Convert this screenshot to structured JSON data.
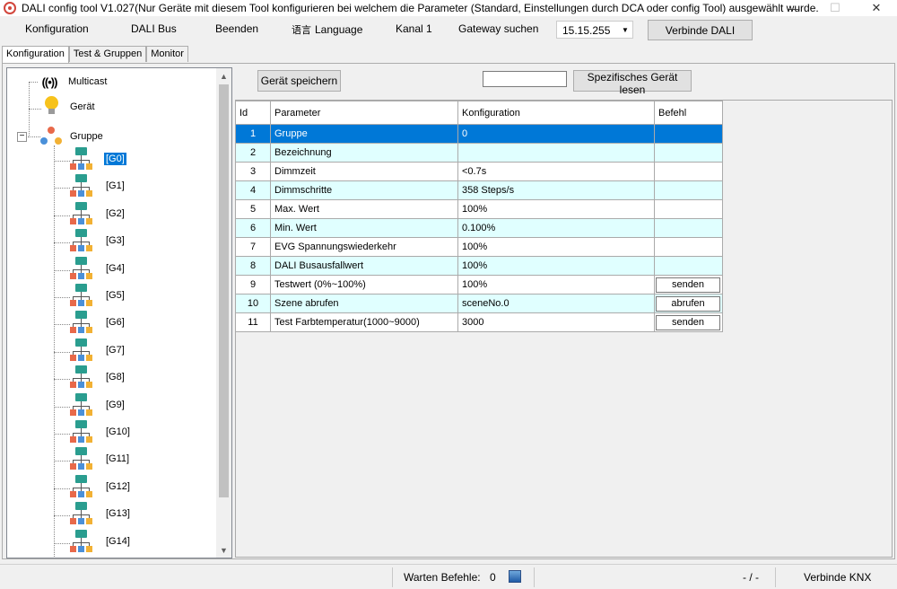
{
  "window": {
    "title": "DALI config tool V1.027(Nur Geräte mit diesem Tool konfigurieren bei welchem die Parameter (Standard, Einstellungen durch DCA oder config Tool) ausgewählt wurde.",
    "controls": {
      "minimize": "—",
      "maximize": "☐",
      "close": "✕"
    }
  },
  "menu": {
    "konfiguration": "Konfiguration",
    "dali_bus": "DALI Bus",
    "beenden": "Beenden",
    "language_icon": "语言",
    "language": "Language",
    "kanal": "Kanal 1",
    "gateway": "Gateway suchen",
    "ip_value": "15.15.255",
    "connect": "Verbinde DALI"
  },
  "tabs": [
    "Konfiguration",
    "Test & Gruppen",
    "Monitor"
  ],
  "tree": {
    "multicast": "Multicast",
    "geraet": "Gerät",
    "gruppe": "Gruppe",
    "groups": [
      "[G0]",
      "[G1]",
      "[G2]",
      "[G3]",
      "[G4]",
      "[G5]",
      "[G6]",
      "[G7]",
      "[G8]",
      "[G9]",
      "[G10]",
      "[G11]",
      "[G12]",
      "[G13]",
      "[G14]"
    ],
    "selected_group": "[G0]"
  },
  "toolbar": {
    "save": "Gerät speichern",
    "address_value": "",
    "read": "Spezifisches Gerät lesen"
  },
  "grid": {
    "headers": {
      "id": "Id",
      "parameter": "Parameter",
      "config": "Konfiguration",
      "action": "Befehl"
    },
    "rows": [
      {
        "id": "1",
        "param": "Gruppe",
        "value": "0",
        "action": ""
      },
      {
        "id": "2",
        "param": "Bezeichnung",
        "value": "",
        "action": ""
      },
      {
        "id": "3",
        "param": "Dimmzeit",
        "value": "<0.7s",
        "action": ""
      },
      {
        "id": "4",
        "param": "Dimmschritte",
        "value": "358 Steps/s",
        "action": ""
      },
      {
        "id": "5",
        "param": "Max. Wert",
        "value": "100%",
        "action": ""
      },
      {
        "id": "6",
        "param": "Min. Wert",
        "value": "0.100%",
        "action": ""
      },
      {
        "id": "7",
        "param": "EVG Spannungswiederkehr",
        "value": "100%",
        "action": ""
      },
      {
        "id": "8",
        "param": "DALI Busausfallwert",
        "value": "100%",
        "action": ""
      },
      {
        "id": "9",
        "param": "Testwert (0%~100%)",
        "value": "100%",
        "action": "senden"
      },
      {
        "id": "10",
        "param": "Szene abrufen",
        "value": "sceneNo.0",
        "action": "abrufen"
      },
      {
        "id": "11",
        "param": "Test Farbtemperatur(1000~9000)",
        "value": "3000",
        "action": "senden"
      }
    ]
  },
  "status": {
    "pending_label": "Warten Befehle:",
    "pending_count": "0",
    "progress": "- / -",
    "knx": "Verbinde KNX"
  }
}
